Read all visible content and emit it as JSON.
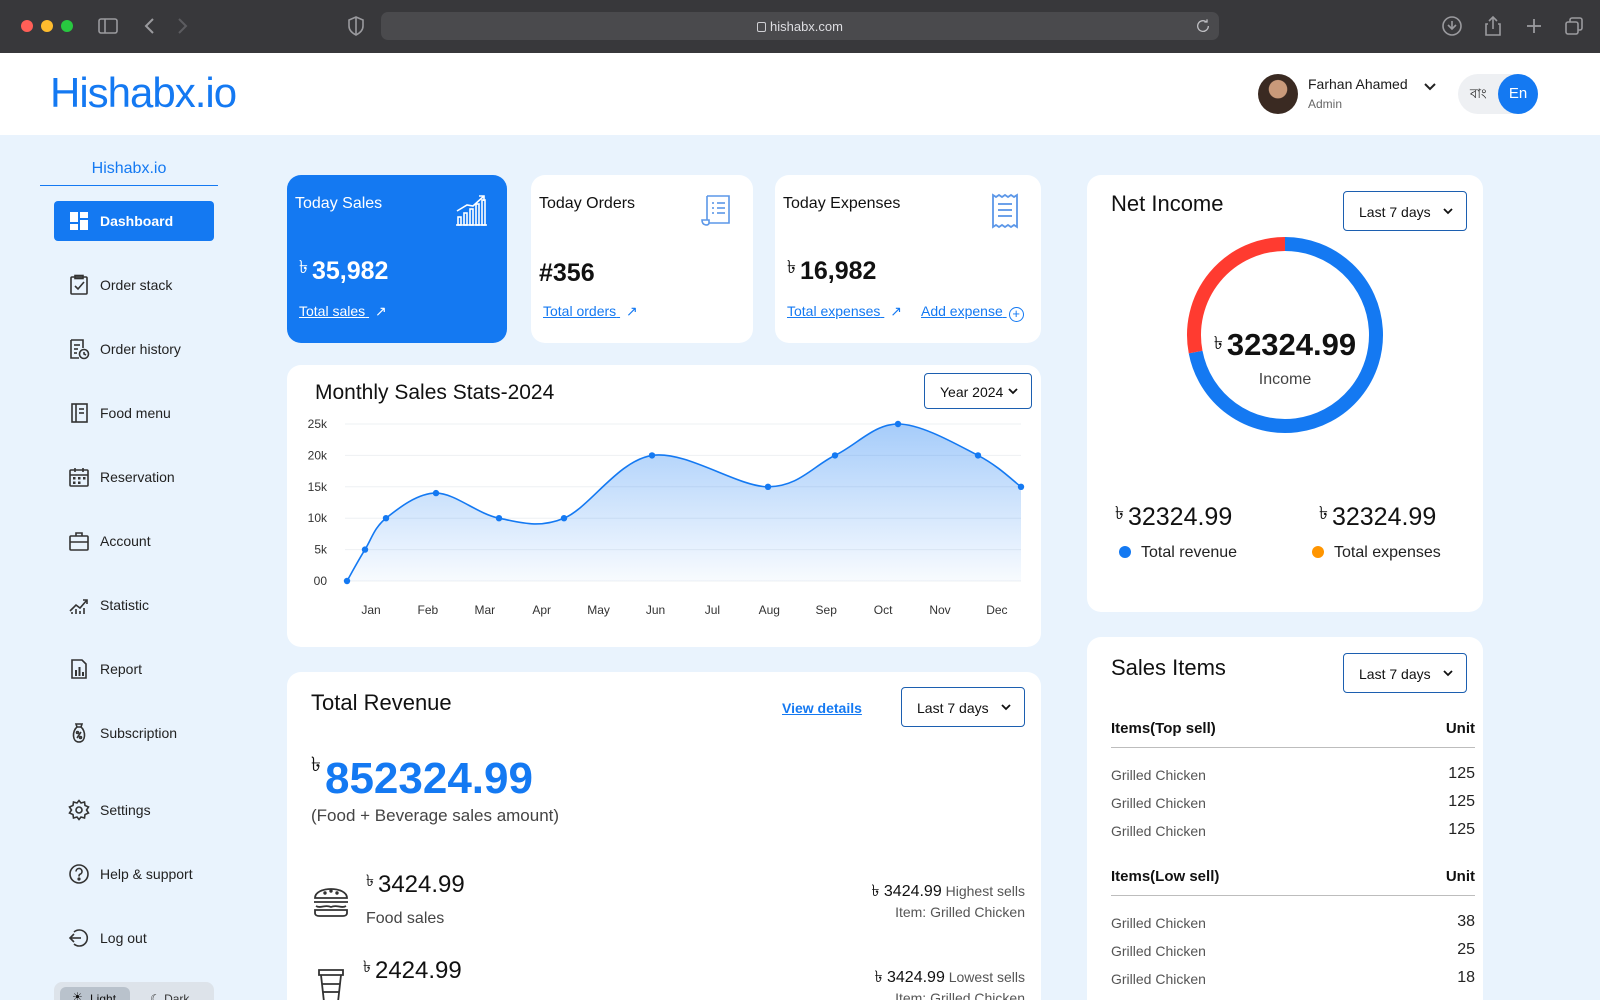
{
  "browser": {
    "url": "hishabx.com"
  },
  "header": {
    "logo": "Hishabx.io",
    "user_name": "Farhan Ahamed",
    "user_role": "Admin",
    "lang_bn": "বাং",
    "lang_en": "En"
  },
  "sidebar": {
    "logo": "Hishabx.io",
    "items": [
      {
        "label": "Dashboard",
        "icon": "dashboard-icon",
        "active": true
      },
      {
        "label": "Order stack",
        "icon": "clipboard-check-icon"
      },
      {
        "label": "Order history",
        "icon": "receipt-clock-icon"
      },
      {
        "label": "Food menu",
        "icon": "menu-book-icon"
      },
      {
        "label": "Reservation",
        "icon": "calendar-icon"
      },
      {
        "label": "Account",
        "icon": "briefcase-icon"
      },
      {
        "label": "Statistic",
        "icon": "chart-trend-icon"
      },
      {
        "label": "Report",
        "icon": "report-icon"
      },
      {
        "label": "Subscription",
        "icon": "percent-bag-icon"
      },
      {
        "label": "Settings",
        "icon": "gear-icon"
      },
      {
        "label": "Help & support",
        "icon": "help-icon"
      },
      {
        "label": "Log out",
        "icon": "logout-icon"
      }
    ],
    "theme_light": "Light",
    "theme_dark": "Dark"
  },
  "stats": {
    "sales": {
      "title": "Today Sales",
      "currency": "৳",
      "value": "35,982",
      "link": "Total sales"
    },
    "orders": {
      "title": "Today Orders",
      "value": "#356",
      "link": "Total orders"
    },
    "expenses": {
      "title": "Today Expenses",
      "currency": "৳",
      "value": "16,982",
      "link": "Total expenses",
      "link2": "Add expense"
    }
  },
  "monthly": {
    "title": "Monthly Sales Stats-2024",
    "dropdown": "Year 2024"
  },
  "chart_data": {
    "type": "area",
    "title": "Monthly Sales Stats-2024",
    "x": [
      "Jan",
      "Feb",
      "Mar",
      "Apr",
      "May",
      "Jun",
      "Jul",
      "Aug",
      "Sep",
      "Oct",
      "Nov",
      "Dec"
    ],
    "y_ticks": [
      "00",
      "5k",
      "10k",
      "15k",
      "20k",
      "25k"
    ],
    "ylim": [
      0,
      25000
    ],
    "points": [
      {
        "x": "Jan",
        "y": 0
      },
      {
        "x": "Jan",
        "y": 5000
      },
      {
        "x": "Jan",
        "y": 10000
      },
      {
        "x": "Feb",
        "y": 14000
      },
      {
        "x": "Mar",
        "y": 10000
      },
      {
        "x": "Apr",
        "y": 10000
      },
      {
        "x": "Jun",
        "y": 20000
      },
      {
        "x": "Aug",
        "y": 15000
      },
      {
        "x": "Sep",
        "y": 20000
      },
      {
        "x": "Oct",
        "y": 25000
      },
      {
        "x": "Nov",
        "y": 20000
      },
      {
        "x": "Dec",
        "y": 15000
      }
    ],
    "color": "#1479f2",
    "grid": true
  },
  "net_income": {
    "title": "Net Income",
    "dropdown": "Last 7 days",
    "currency": "৳",
    "center_value": "32324.99",
    "center_label": "Income",
    "revenue_value": "32324.99",
    "revenue_label": "Total revenue",
    "expenses_value": "32324.99",
    "expenses_label": "Total expenses",
    "revenue_color": "#1479f2",
    "expenses_color": "#ff9500",
    "donut": {
      "blue_fraction": 0.72,
      "red_fraction": 0.28,
      "red_color": "#ff3b30"
    }
  },
  "sales_items": {
    "title": "Sales Items",
    "dropdown": "Last 7 days",
    "top_header": "Items(Top sell)",
    "low_header": "Items(Low sell)",
    "unit_header": "Unit",
    "top": [
      {
        "name": "Grilled Chicken",
        "unit": "125"
      },
      {
        "name": "Grilled Chicken",
        "unit": "125"
      },
      {
        "name": "Grilled Chicken",
        "unit": "125"
      }
    ],
    "low": [
      {
        "name": "Grilled Chicken",
        "unit": "38"
      },
      {
        "name": "Grilled Chicken",
        "unit": "25"
      },
      {
        "name": "Grilled Chicken",
        "unit": "18"
      }
    ]
  },
  "revenue": {
    "title": "Total Revenue",
    "view_details": "View details",
    "dropdown": "Last 7 days",
    "currency": "৳",
    "total": "852324.99",
    "subtitle": "(Food + Beverage sales amount)",
    "food_value": "3424.99",
    "food_label": "Food sales",
    "food_high_value": "3424.99",
    "food_high_label": "Highest sells",
    "food_item": "Item: Grilled Chicken",
    "bev_value": "2424.99",
    "bev_low_value": "3424.99",
    "bev_low_label": "Lowest sells",
    "bev_item": "Item: Grilled Chicken"
  }
}
